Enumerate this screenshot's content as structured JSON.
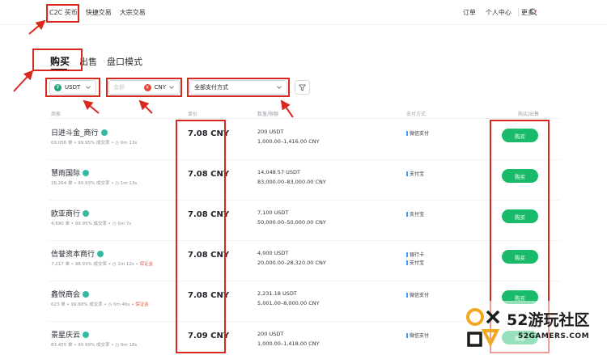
{
  "nav": {
    "left_items": [
      "C2C 买币",
      "快捷交易",
      "大宗交易"
    ],
    "right_items": [
      "订单",
      "个人中心",
      "更多"
    ]
  },
  "tabs": [
    "购买",
    "出售",
    "盘口模式"
  ],
  "filters": {
    "crypto": "USDT",
    "amount_placeholder": "金额",
    "fiat": "CNY",
    "payment": "全部支付方式"
  },
  "table": {
    "headers": [
      "商家",
      "单价",
      "数量/限额",
      "支付方式",
      "购买/出售"
    ],
    "rows": [
      {
        "name": "日进斗金_商行",
        "stats": "69,056 单 • 99.95% 成交率 • ◷ 0m 13s",
        "warn": "",
        "price": "7.08 CNY",
        "qty": "200 USDT",
        "limit": "1,000.00–1,416.00 CNY",
        "payments": [
          "微信支付"
        ],
        "action": "购买"
      },
      {
        "name": "慧雨国际",
        "stats": "26,264 单 • 99.93% 成交率 • ◷ 1m 13s",
        "warn": "",
        "price": "7.08 CNY",
        "qty": "14,048.57 USDT",
        "limit": "83,000.00–83,000.00 CNY",
        "payments": [
          "支付宝"
        ],
        "action": "购买"
      },
      {
        "name": "欧亚商行",
        "stats": "4,690 单 • 99.95% 成交率 • ◷ 0m 7s",
        "warn": "",
        "price": "7.08 CNY",
        "qty": "7,100 USDT",
        "limit": "50,000.00–50,000.00 CNY",
        "payments": [
          "支付宝"
        ],
        "action": "购买"
      },
      {
        "name": "信誉资本商行",
        "stats": "7,217 单 • 98.93% 成交率 • ◷ 1m 12s •",
        "warn": "保证金",
        "price": "7.08 CNY",
        "qty": "4,000 USDT",
        "limit": "20,000.00–28,320.00 CNY",
        "payments": [
          "银行卡",
          "支付宝"
        ],
        "action": "购买"
      },
      {
        "name": "鑫悦商会",
        "stats": "623 单 • 99.68% 成交率 • ◷ 0m 46s •",
        "warn": "保证金",
        "price": "7.08 CNY",
        "qty": "2,231.18 USDT",
        "limit": "5,001.00–8,000.00 CNY",
        "payments": [
          "微信支付"
        ],
        "action": "购买"
      },
      {
        "name": "景星庆云",
        "stats": "83,455 单 • 99.99% 成交率 • ◷ 0m 18s",
        "warn": "",
        "price": "7.09 CNY",
        "qty": "200 USDT",
        "limit": "1,000.00–1,418.00 CNY",
        "payments": [
          "微信支付"
        ],
        "action": "购买"
      }
    ]
  },
  "watermark": {
    "brand": "52游玩社区",
    "site": "52GAMERS.COM"
  },
  "colors": {
    "accent_green": "#19ba6a",
    "annotation_red": "#d9281f",
    "verified": "#35b9a3",
    "usdt": "#26a17b",
    "cny": "#e0473b"
  }
}
